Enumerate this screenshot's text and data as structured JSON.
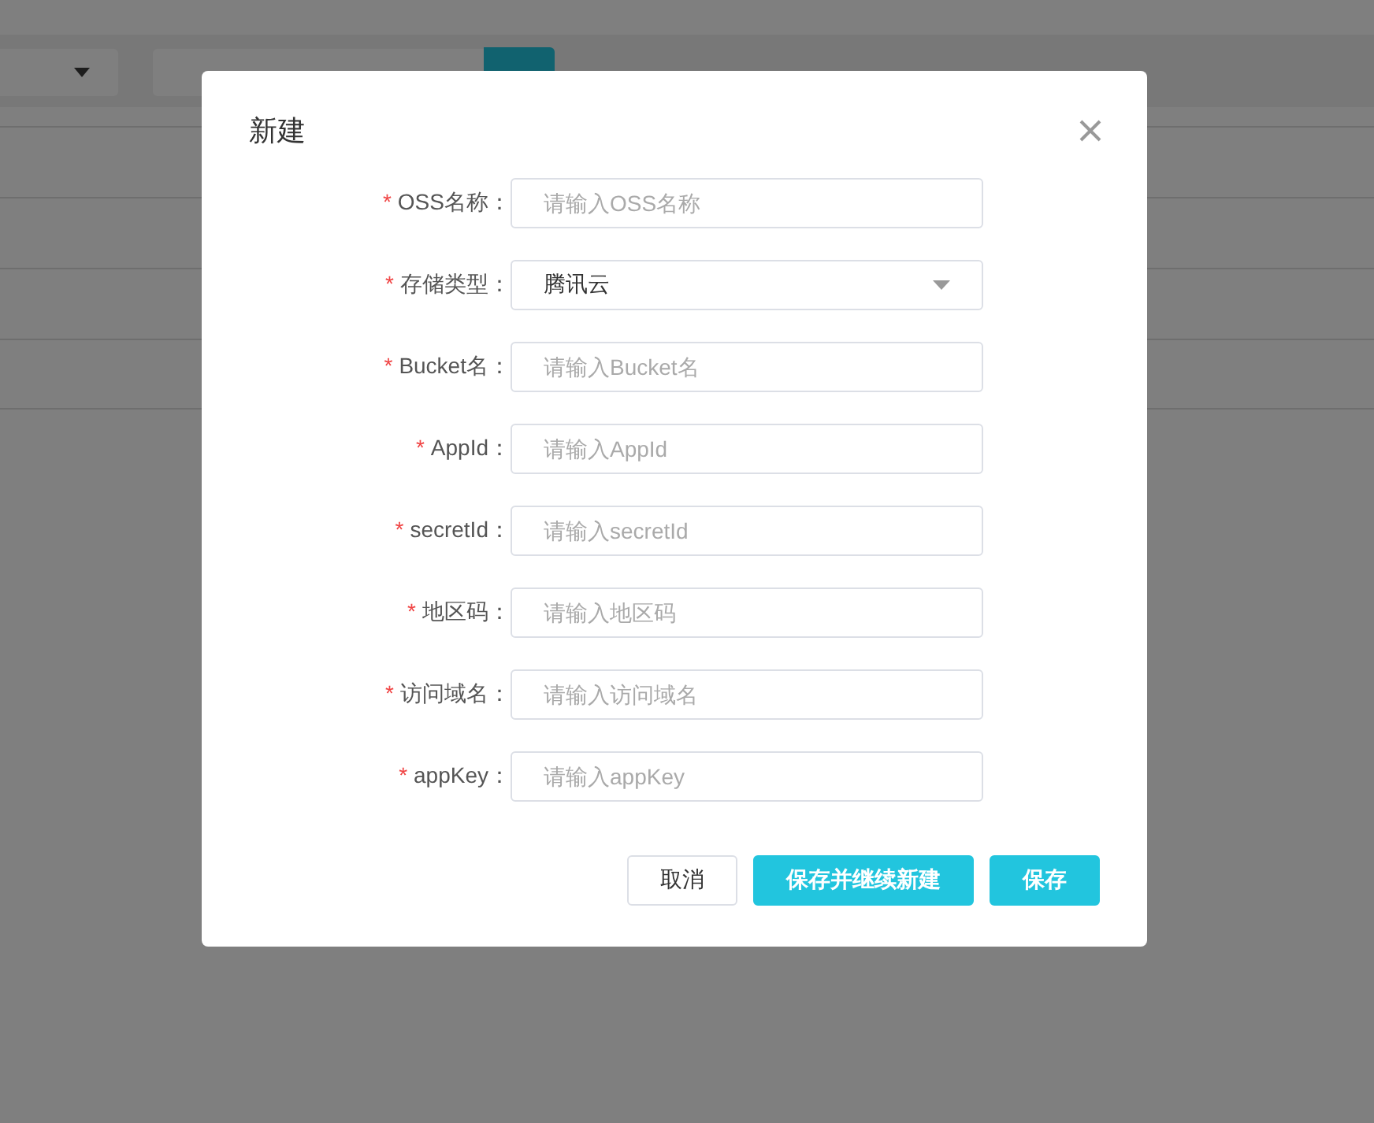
{
  "dialog": {
    "title": "新建",
    "fields": [
      {
        "label": "OSS名称：",
        "required_mark": "*",
        "kind": "input",
        "placeholder": "请输入OSS名称"
      },
      {
        "label": "存储类型：",
        "required_mark": "*",
        "kind": "select",
        "value": "腾讯云"
      },
      {
        "label": "Bucket名：",
        "required_mark": "*",
        "kind": "input",
        "placeholder": "请输入Bucket名"
      },
      {
        "label": "AppId：",
        "required_mark": "*",
        "kind": "input",
        "placeholder": "请输入AppId"
      },
      {
        "label": "secretId：",
        "required_mark": "*",
        "kind": "input",
        "placeholder": "请输入secretId"
      },
      {
        "label": "地区码：",
        "required_mark": "*",
        "kind": "input",
        "placeholder": "请输入地区码"
      },
      {
        "label": "访问域名：",
        "required_mark": "*",
        "kind": "input",
        "placeholder": "请输入访问域名"
      },
      {
        "label": "appKey：",
        "required_mark": "*",
        "kind": "input",
        "placeholder": "请输入appKey"
      }
    ],
    "buttons": [
      {
        "label": "取消",
        "kind": "default"
      },
      {
        "label": "保存并继续新建",
        "kind": "primary"
      },
      {
        "label": "保存",
        "kind": "primary"
      }
    ]
  }
}
